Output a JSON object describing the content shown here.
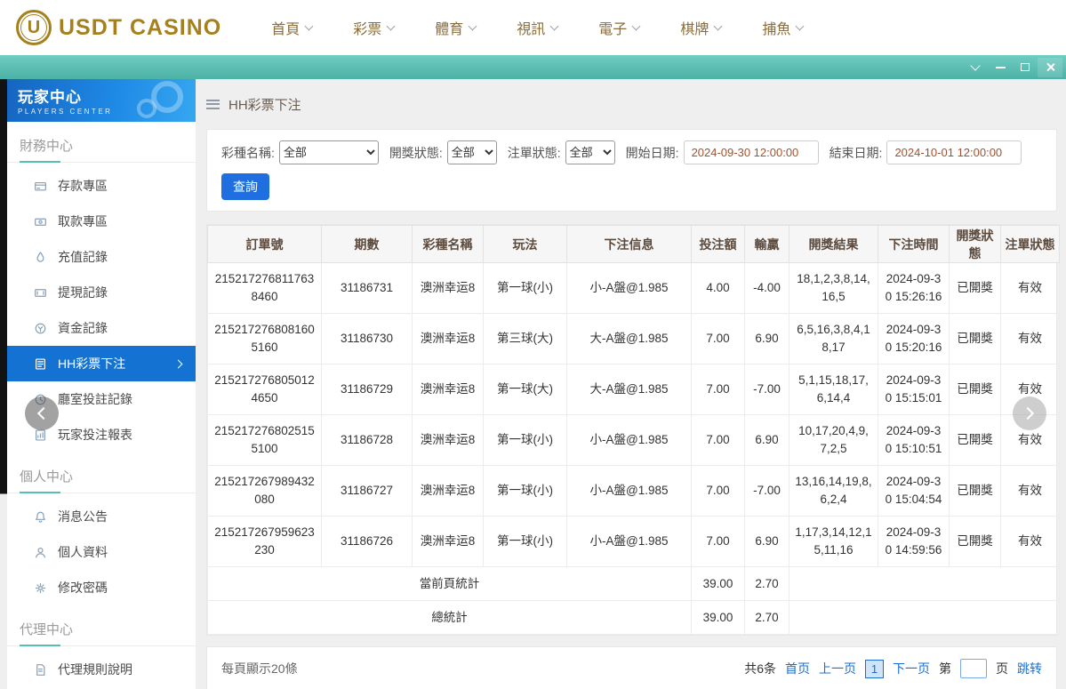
{
  "colors": {
    "gold": "#a5801c",
    "teal": "#56bfb3",
    "accent_blue": "#1f6fe0",
    "active_blue": "#1473d2",
    "link_blue": "#1a6fd4",
    "date_text": "#a0522d"
  },
  "topnav": {
    "logo_letter": "U",
    "logo_text": "USDT CASINO",
    "items": [
      {
        "label": "首頁"
      },
      {
        "label": "彩票"
      },
      {
        "label": "體育"
      },
      {
        "label": "視訊"
      },
      {
        "label": "電子"
      },
      {
        "label": "棋牌"
      },
      {
        "label": "捕魚"
      }
    ]
  },
  "titlebar": {
    "controls": [
      "chevron-down",
      "minimize",
      "maximize",
      "close"
    ]
  },
  "sidebar": {
    "title": "玩家中心",
    "subtitle": "PLAYERS CENTER",
    "sections": [
      {
        "title": "財務中心",
        "items": [
          {
            "label": "存款專區",
            "icon": "deposit",
            "active": false
          },
          {
            "label": "取款專區",
            "icon": "withdraw",
            "active": false
          },
          {
            "label": "充值記錄",
            "icon": "recharge",
            "active": false
          },
          {
            "label": "提現記錄",
            "icon": "cashout",
            "active": false
          },
          {
            "label": "資金記錄",
            "icon": "funds",
            "active": false
          },
          {
            "label": "HH彩票下注",
            "icon": "lottery",
            "active": true
          },
          {
            "label": "廳室投註記錄",
            "icon": "room",
            "active": false
          },
          {
            "label": "玩家投注報表",
            "icon": "report",
            "active": false
          }
        ]
      },
      {
        "title": "個人中心",
        "items": [
          {
            "label": "消息公告",
            "icon": "bell",
            "active": false
          },
          {
            "label": "個人資料",
            "icon": "user",
            "active": false
          },
          {
            "label": "修改密碼",
            "icon": "gear",
            "active": false
          }
        ]
      },
      {
        "title": "代理中心",
        "items": [
          {
            "label": "代理規則說明",
            "icon": "doc",
            "active": false
          }
        ]
      }
    ]
  },
  "main": {
    "breadcrumb": "HH彩票下注",
    "filters": {
      "lottery_label": "彩種名稱:",
      "lottery_value": "全部",
      "draw_status_label": "開獎狀態:",
      "draw_status_value": "全部",
      "order_status_label": "注單狀態:",
      "order_status_value": "全部",
      "start_label": "開始日期:",
      "start_value": "2024-09-30 12:00:00",
      "end_label": "結束日期:",
      "end_value": "2024-10-01 12:00:00",
      "search_button": "查詢"
    },
    "table": {
      "headers": [
        "訂單號",
        "期數",
        "彩種名稱",
        "玩法",
        "下注信息",
        "投注額",
        "輸贏",
        "開獎結果",
        "下注時間",
        "開獎狀態",
        "注單狀態"
      ],
      "rows": [
        [
          "2152172768117638460",
          "31186731",
          "澳洲幸运8",
          "第一球(小)",
          "小-A盤@1.985",
          "4.00",
          "-4.00",
          "18,1,2,3,8,14,16,5",
          "2024-09-30 15:26:16",
          "已開獎",
          "有效"
        ],
        [
          "2152172768081605160",
          "31186730",
          "澳洲幸运8",
          "第三球(大)",
          "大-A盤@1.985",
          "7.00",
          "6.90",
          "6,5,16,3,8,4,18,17",
          "2024-09-30 15:20:16",
          "已開獎",
          "有效"
        ],
        [
          "2152172768050124650",
          "31186729",
          "澳洲幸运8",
          "第一球(大)",
          "大-A盤@1.985",
          "7.00",
          "-7.00",
          "5,1,15,18,17,6,14,4",
          "2024-09-30 15:15:01",
          "已開獎",
          "有效"
        ],
        [
          "2152172768025155100",
          "31186728",
          "澳洲幸运8",
          "第一球(小)",
          "小-A盤@1.985",
          "7.00",
          "6.90",
          "10,17,20,4,9,7,2,5",
          "2024-09-30 15:10:51",
          "已開獎",
          "有效"
        ],
        [
          "215217267989432080",
          "31186727",
          "澳洲幸运8",
          "第一球(小)",
          "小-A盤@1.985",
          "7.00",
          "-7.00",
          "13,16,14,19,8,6,2,4",
          "2024-09-30 15:04:54",
          "已開獎",
          "有效"
        ],
        [
          "215217267959623230",
          "31186726",
          "澳洲幸运8",
          "第一球(小)",
          "小-A盤@1.985",
          "7.00",
          "6.90",
          "1,17,3,14,12,15,11,16",
          "2024-09-30 14:59:56",
          "已開獎",
          "有效"
        ]
      ],
      "summary_rows": [
        {
          "label": "當前頁統計",
          "bet_amount": "39.00",
          "win_loss": "2.70"
        },
        {
          "label": "總統計",
          "bet_amount": "39.00",
          "win_loss": "2.70"
        }
      ]
    },
    "pagination": {
      "page_size_text": "每頁顯示20條",
      "total_text": "共6条",
      "first": "首页",
      "prev": "上一页",
      "current": "1",
      "next": "下一页",
      "jump_prefix": "第",
      "jump_suffix": "页",
      "jump_button": "跳转"
    }
  }
}
